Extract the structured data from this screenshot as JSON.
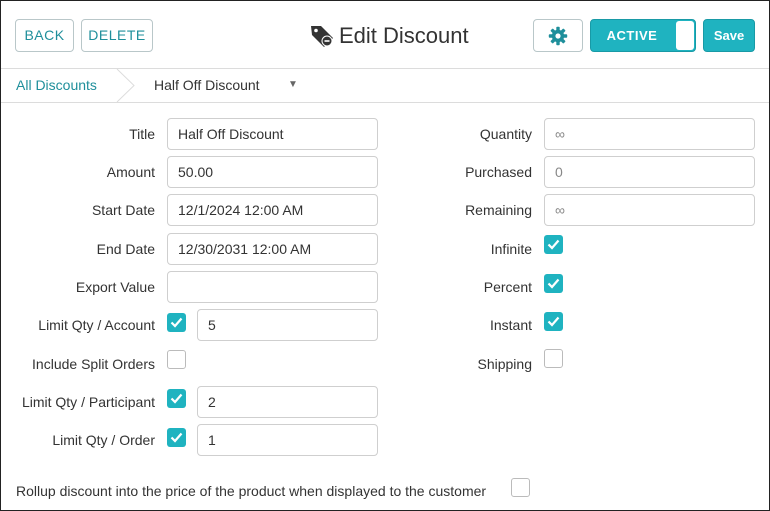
{
  "header": {
    "back_label": "BACK",
    "delete_label": "DELETE",
    "title": "Edit Discount",
    "title_icon": "tag-icon",
    "settings_icon": "gear-icon",
    "status_toggle_label": "ACTIVE",
    "save_label": "Save"
  },
  "breadcrumb": {
    "root": "All Discounts",
    "current": "Half Off Discount",
    "caret": "▼"
  },
  "form": {
    "title_label": "Title",
    "title_value": "Half Off Discount",
    "amount_label": "Amount",
    "amount_value": "50.00",
    "start_date_label": "Start Date",
    "start_date_value": "12/1/2024 12:00 AM",
    "end_date_label": "End Date",
    "end_date_value": "12/30/2031 12:00 AM",
    "export_value_label": "Export Value",
    "export_value_value": "",
    "limit_account_label": "Limit Qty / Account",
    "limit_account_checked": true,
    "limit_account_value": "5",
    "split_orders_label": "Include Split Orders",
    "split_orders_checked": false,
    "limit_participant_label": "Limit Qty / Participant",
    "limit_participant_checked": true,
    "limit_participant_value": "2",
    "limit_order_label": "Limit Qty / Order",
    "limit_order_checked": true,
    "limit_order_value": "1",
    "quantity_label": "Quantity",
    "quantity_value": "∞",
    "purchased_label": "Purchased",
    "purchased_value": "0",
    "remaining_label": "Remaining",
    "remaining_value": "∞",
    "infinite_label": "Infinite",
    "infinite_checked": true,
    "percent_label": "Percent",
    "percent_checked": true,
    "instant_label": "Instant",
    "instant_checked": true,
    "shipping_label": "Shipping",
    "shipping_checked": false,
    "rollup_label": "Rollup discount into the price of the product when displayed to the customer",
    "rollup_checked": false
  },
  "colors": {
    "accent": "#1fb3c0",
    "link": "#1f8f9b"
  }
}
